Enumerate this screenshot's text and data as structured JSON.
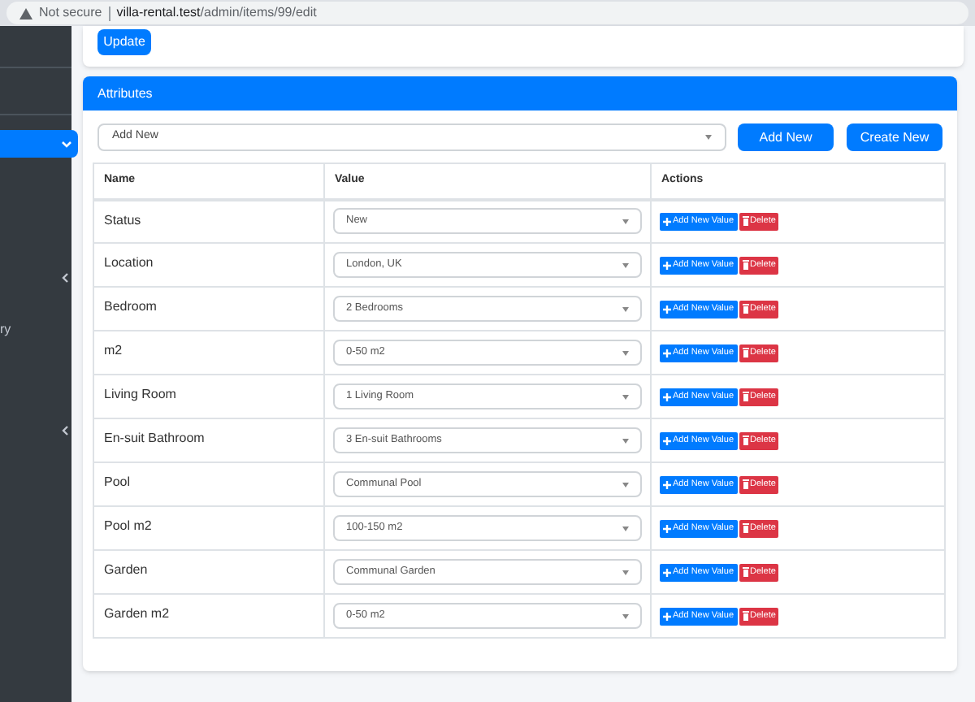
{
  "browser": {
    "security": "Not secure",
    "url_host": "villa-rental.test",
    "url_path": "/admin/items/99/edit"
  },
  "sidebar": {
    "items": [
      {
        "kind": "active"
      },
      {
        "kind": "collapsed"
      },
      {
        "kind": "text",
        "label": "ry"
      },
      {
        "kind": "collapsed"
      }
    ]
  },
  "top_card": {
    "button": "Update"
  },
  "attributes": {
    "title": "Attributes",
    "select": {
      "value": "Add New"
    },
    "buttons": [
      "Add New",
      "Create New"
    ],
    "table": {
      "columns": [
        "Name",
        "Value",
        "Actions"
      ],
      "rows": [
        {
          "name": "Status",
          "value": "New",
          "actions": [
            "Add New Value",
            "Delete"
          ]
        },
        {
          "name": "Location",
          "value": "London, UK",
          "actions": [
            "Add New Value",
            "Delete"
          ]
        },
        {
          "name": "Bedroom",
          "value": "2 Bedrooms",
          "actions": [
            "Add New Value",
            "Delete"
          ]
        },
        {
          "name": "m2",
          "value": "0-50 m2",
          "actions": [
            "Add New Value",
            "Delete"
          ]
        },
        {
          "name": "Living Room",
          "value": "1 Living Room",
          "actions": [
            "Add New Value",
            "Delete"
          ]
        },
        {
          "name": "En-suit Bathroom",
          "value": "3 En-suit Bathrooms",
          "actions": [
            "Add New Value",
            "Delete"
          ]
        },
        {
          "name": "Pool",
          "value": "Communal Pool",
          "actions": [
            "Add New Value",
            "Delete"
          ]
        },
        {
          "name": "Pool m2",
          "value": "100-150 m2",
          "actions": [
            "Add New Value",
            "Delete"
          ]
        },
        {
          "name": "Garden",
          "value": "Communal Garden",
          "actions": [
            "Add New Value",
            "Delete"
          ]
        },
        {
          "name": "Garden m2",
          "value": "0-50 m2",
          "actions": [
            "Add New Value",
            "Delete"
          ]
        }
      ]
    }
  }
}
